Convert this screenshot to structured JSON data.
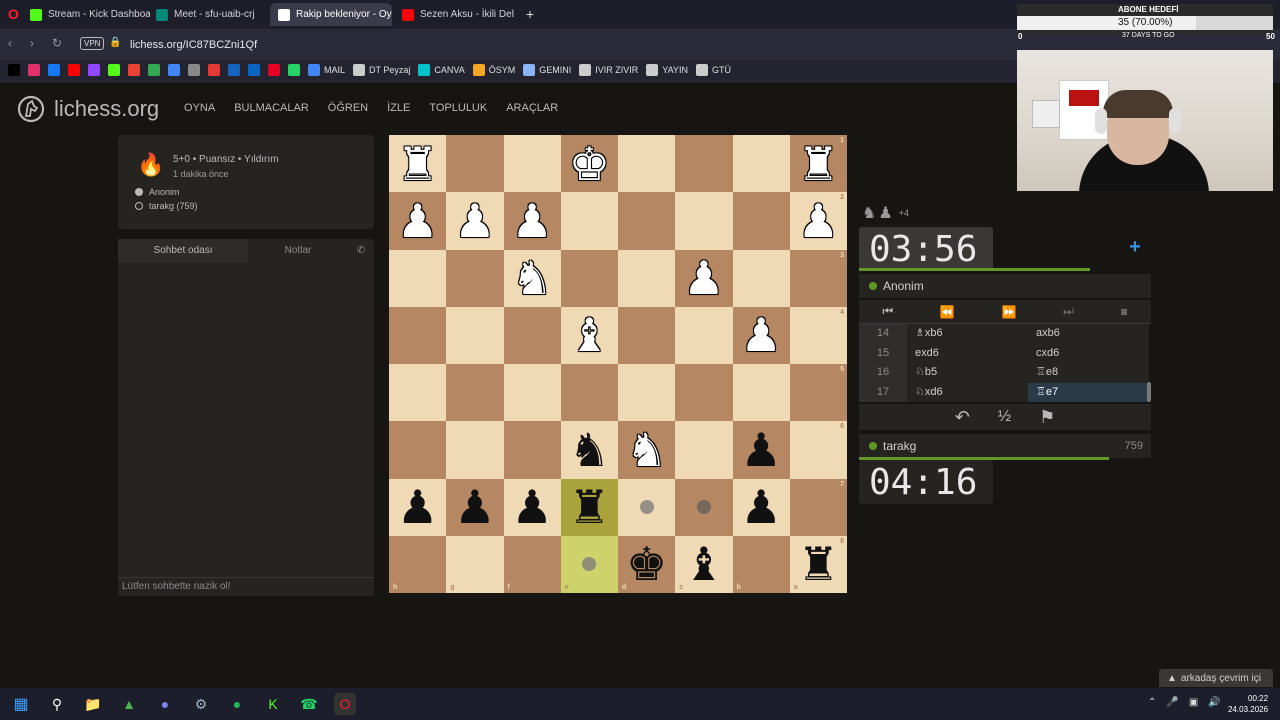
{
  "browser": {
    "tabs": [
      {
        "title": "Stream - Kick Dashboard",
        "color": "#53fc18"
      },
      {
        "title": "Meet - sfu-uaib-crj",
        "color": "#00897b"
      },
      {
        "title": "Rakip bekleniyor - Oy",
        "color": "#ffffff"
      },
      {
        "title": "Sezen Aksu - İkili Delil",
        "color": "#ff0000"
      }
    ],
    "url": "lichess.org/IC87BCZni1Qf",
    "vpn_label": "VPN",
    "bookmarks": [
      {
        "label": "",
        "color": "#000000"
      },
      {
        "label": "",
        "color": "#e1306c"
      },
      {
        "label": "",
        "color": "#1877f2"
      },
      {
        "label": "",
        "color": "#ff0000"
      },
      {
        "label": "",
        "color": "#9146ff"
      },
      {
        "label": "",
        "color": "#53fc18"
      },
      {
        "label": "",
        "color": "#ea4335"
      },
      {
        "label": "",
        "color": "#34a853"
      },
      {
        "label": "",
        "color": "#4285f4"
      },
      {
        "label": "",
        "color": "#888888"
      },
      {
        "label": "",
        "color": "#e53935"
      },
      {
        "label": "",
        "color": "#1565c0"
      },
      {
        "label": "",
        "color": "#0a66c2"
      },
      {
        "label": "",
        "color": "#e60023"
      },
      {
        "label": "",
        "color": "#25d366"
      },
      {
        "label": "MAIL",
        "color": "#4285f4"
      },
      {
        "label": "DT Peyzaj",
        "color": "#cccccc"
      },
      {
        "label": "CANVA",
        "color": "#00c4cc"
      },
      {
        "label": "ÖSYM",
        "color": "#f5a623"
      },
      {
        "label": "GEMINI",
        "color": "#8ab4f8"
      },
      {
        "label": "IVIR ZIVIR",
        "color": "#cccccc"
      },
      {
        "label": "YAYIN",
        "color": "#cccccc"
      },
      {
        "label": "GTÜ",
        "color": "#cccccc"
      }
    ]
  },
  "site": {
    "logo": "lichess.org",
    "nav": [
      "OYNA",
      "BULMACALAR",
      "ÖĞREN",
      "İZLE",
      "TOPLULUK",
      "ARAÇLAR"
    ]
  },
  "game": {
    "mode": "5+0 • Puansız • Yıldırım",
    "started": "1 dakika önce",
    "player_white": "Anonim",
    "player_black": "tarakg (759)"
  },
  "chat": {
    "tab_chat": "Sohbet odası",
    "tab_notes": "Notlar",
    "placeholder": "Lütfen sohbette nazik ol!"
  },
  "board": {
    "files_label": [
      "h",
      "g",
      "f",
      "e",
      "d",
      "c",
      "b",
      "a"
    ],
    "ranks_label": [
      "1",
      "2",
      "3",
      "4",
      "5",
      "6",
      "7",
      "8"
    ],
    "pieces": [
      [
        "wR",
        "",
        "",
        "wK",
        "",
        "",
        "",
        "wR"
      ],
      [
        "wP",
        "wP",
        "wP",
        "",
        "",
        "",
        "",
        "wP"
      ],
      [
        "",
        "",
        "wN",
        "",
        "",
        "wP",
        "",
        ""
      ],
      [
        "",
        "",
        "",
        "wB",
        "",
        "",
        "wP",
        ""
      ],
      [
        "",
        "",
        "",
        "",
        "",
        "",
        "",
        ""
      ],
      [
        "",
        "",
        "",
        "bN",
        "wN",
        "",
        "bP",
        ""
      ],
      [
        "bP",
        "bP",
        "bP",
        "bR",
        "",
        "",
        "bP",
        ""
      ],
      [
        "",
        "",
        "",
        "",
        "bK",
        "bB",
        "",
        "bR"
      ]
    ]
  },
  "opponent": {
    "name": "Anonim",
    "clock": "03:56",
    "captured_extra": "+4"
  },
  "self": {
    "name": "tarakg",
    "rating": "759",
    "clock": "04:16"
  },
  "moves": [
    {
      "n": "14",
      "w": "♗xb6",
      "b": "axb6"
    },
    {
      "n": "15",
      "w": "exd6",
      "b": "cxd6"
    },
    {
      "n": "16",
      "w": "♘b5",
      "b": "♖e8"
    },
    {
      "n": "17",
      "w": "♘xd6",
      "b": "♖e7"
    }
  ],
  "overlay": {
    "goal_title": "ABONE HEDEFİ",
    "goal_count": "35 (70.00%)",
    "goal_progress": 0.7,
    "goal_days": "37 DAYS TO GO",
    "goal_start": "0",
    "goal_end": "50"
  },
  "friends": "arkadaş çevrim içi",
  "clock": {
    "time": "00:22",
    "date": "24.03.2026"
  }
}
